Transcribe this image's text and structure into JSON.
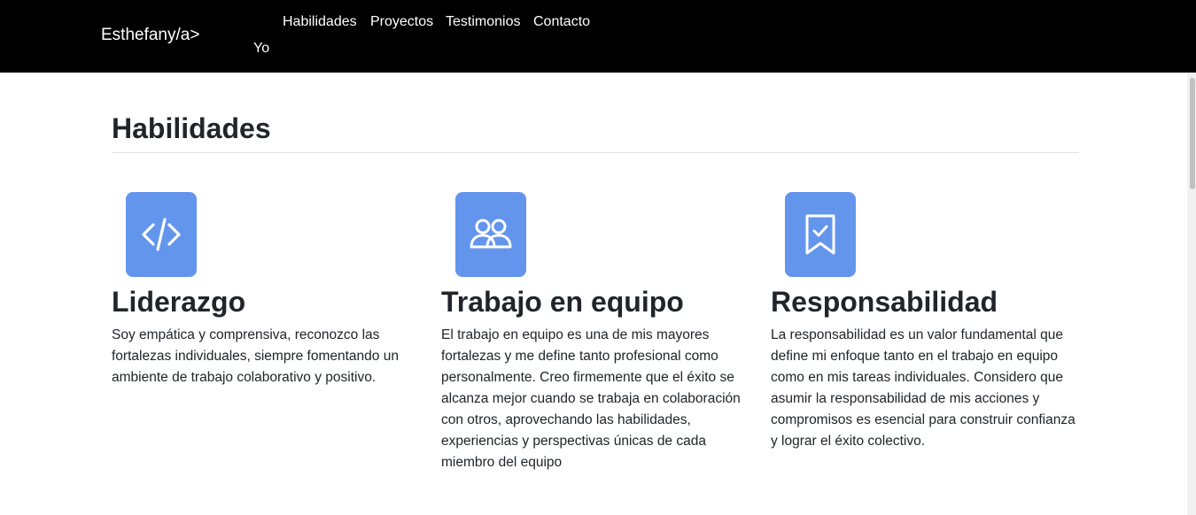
{
  "navbar": {
    "brand": "Esthefany/a>",
    "links": [
      "Yo",
      "Habilidades",
      "Proyectos",
      "Testimonios",
      "Contacto"
    ]
  },
  "section": {
    "title": "Habilidades"
  },
  "skills": [
    {
      "icon": "code-icon",
      "title": "Liderazgo",
      "text": "Soy empática y comprensiva, reconozco las fortalezas individuales, siempre fomentando un ambiente de trabajo colaborativo y positivo."
    },
    {
      "icon": "people-icon",
      "title": "Trabajo en equipo",
      "text": "El trabajo en equipo es una de mis mayores fortalezas y me define tanto profesional como personalmente. Creo firmemente que el éxito se alcanza mejor cuando se trabaja en colaboración con otros, aprovechando las habilidades, experiencias y perspectivas únicas de cada miembro del equipo"
    },
    {
      "icon": "bookmark-check-icon",
      "title": "Responsabilidad",
      "text": "La responsabilidad es un valor fundamental que define mi enfoque tanto en el trabajo en equipo como en mis tareas individuales. Considero que asumir la responsabilidad de mis acciones y compromisos es esencial para construir confianza y lograr el éxito colectivo."
    }
  ],
  "colors": {
    "navbar_bg": "#000000",
    "icon_bg": "#6495ed",
    "text": "#212529"
  }
}
